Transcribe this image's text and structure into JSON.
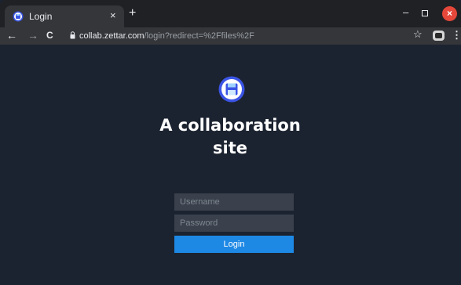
{
  "browser": {
    "tab": {
      "title": "Login",
      "close_glyph": "×"
    },
    "new_tab_glyph": "+",
    "window_controls": {
      "minimize": "–",
      "close": "×"
    },
    "nav": {
      "back": "←",
      "forward": "→",
      "reload": "C"
    },
    "address": {
      "host": "collab.zettar.com",
      "path": "/login?redirect=%2Ffiles%2F"
    },
    "star_glyph": "☆",
    "menu_glyph": "⋮"
  },
  "login": {
    "site_title": "A collaboration site",
    "username_placeholder": "Username",
    "password_placeholder": "Password",
    "login_label": "Login"
  },
  "icons": {
    "favicon": "floppy-disk-icon",
    "logo": "floppy-disk-icon",
    "lock": "lock-icon"
  },
  "colors": {
    "accent": "#1e88e5",
    "logo_ring": "#3b55e6",
    "page_bg": "#1c2330",
    "input_bg": "#3a414c"
  }
}
